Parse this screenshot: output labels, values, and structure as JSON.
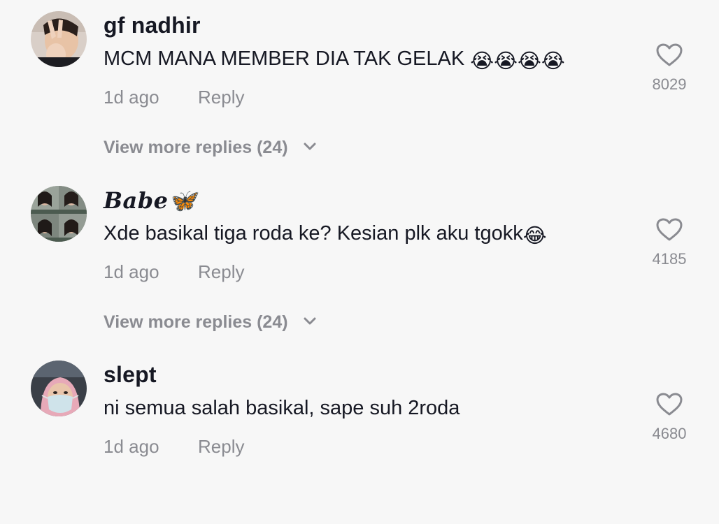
{
  "comments": [
    {
      "username": "gf nadhir",
      "text": "MCM MANA MEMBER DIA TAK GELAK",
      "emoji": "😭😭😭😭",
      "time": "1d ago",
      "reply_label": "Reply",
      "likes": "8029",
      "view_more": "View more replies (24)"
    },
    {
      "username": "Babe🦋",
      "text": "Xde basikal tiga roda ke? Kesian plk aku tgokk",
      "emoji": "😂",
      "time": "1d ago",
      "reply_label": "Reply",
      "likes": "4185",
      "view_more": "View more replies (24)"
    },
    {
      "username": "slept",
      "text": "ni semua salah basikal, sape suh 2roda",
      "emoji": "",
      "time": "1d ago",
      "reply_label": "Reply",
      "likes": "4680"
    }
  ],
  "icons": {
    "like": "heart-outline-icon",
    "expand": "chevron-down-icon"
  },
  "colors": {
    "background": "#f7f7f7",
    "text": "#161823",
    "muted": "#8a8b91"
  }
}
